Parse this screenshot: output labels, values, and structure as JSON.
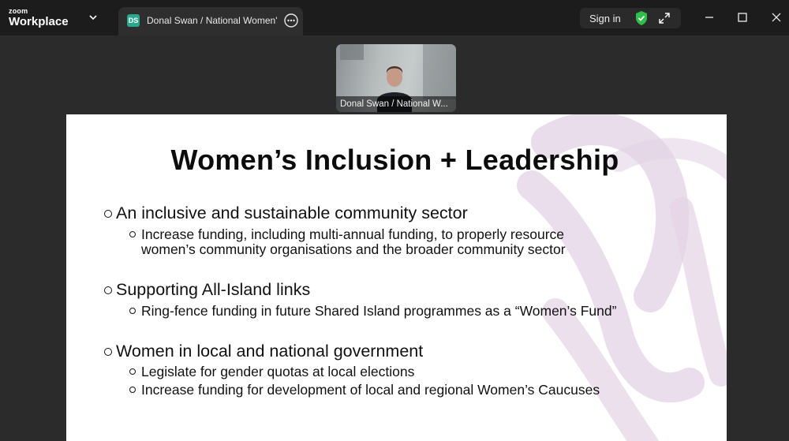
{
  "app": {
    "brand_small": "zoom",
    "brand_large": "Workplace"
  },
  "tab": {
    "avatar_initials": "DS",
    "title": "Donal Swan / National Women's Council"
  },
  "header": {
    "sign_in_label": "Sign in"
  },
  "video": {
    "participant_name": "Donal Swan / National W..."
  },
  "slide": {
    "title": "Women’s Inclusion + Leadership",
    "sections": [
      {
        "heading": "An inclusive and sustainable community sector",
        "items": [
          "Increase funding, including multi-annual funding, to properly resource",
          "women’s community organisations and the broader community sector"
        ]
      },
      {
        "heading": "Supporting All-Island links",
        "items": [
          "Ring-fence funding in future Shared Island programmes as a “Women’s Fund”"
        ]
      },
      {
        "heading": "Women in local and national government",
        "items": [
          "Legislate for gender quotas at local elections",
          "Increase funding for development of local and regional Women’s Caucuses"
        ]
      }
    ]
  },
  "colors": {
    "titlebar": "#1c1c1c",
    "background": "#2b2b2b",
    "avatar": "#2aa88f",
    "shield": "#2fbf4a",
    "deco": "#e4d3e6"
  }
}
